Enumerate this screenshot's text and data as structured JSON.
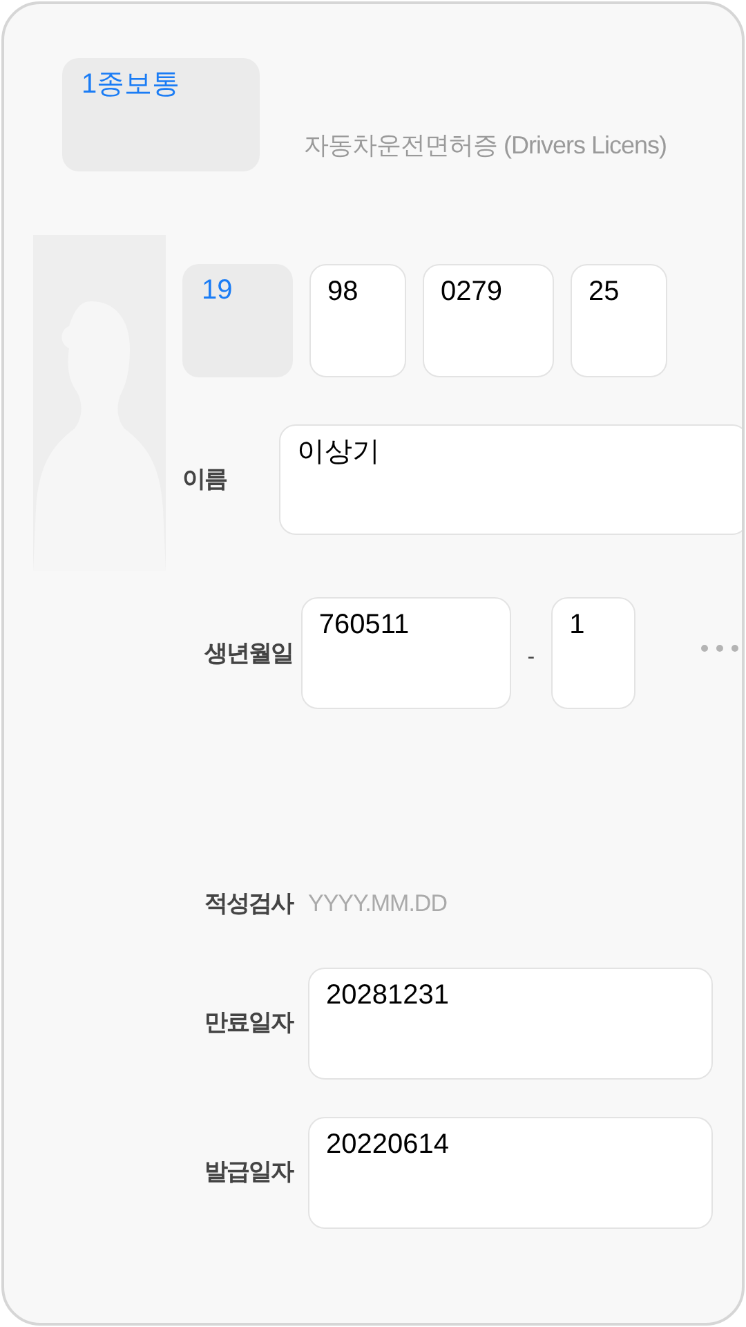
{
  "license_type": {
    "label": "1종보통"
  },
  "title": "자동차운전면허증 (Drivers Licens)",
  "license_number": [
    {
      "kind": "select",
      "value": "19"
    },
    {
      "kind": "field",
      "value": "98"
    },
    {
      "kind": "field",
      "value": "0279"
    },
    {
      "kind": "field",
      "value": "25"
    }
  ],
  "name": {
    "label": "이름",
    "value": "이상기"
  },
  "birth": {
    "label": "생년월일",
    "value": "760511",
    "separator": "-",
    "gender_digit": "1"
  },
  "aptitude_test": {
    "label": "적성검사",
    "placeholder": "YYYY.MM.DD"
  },
  "expiry": {
    "label": "만료일자",
    "value": "20281231"
  },
  "issue": {
    "label": "발급일자",
    "value": "20220614"
  }
}
